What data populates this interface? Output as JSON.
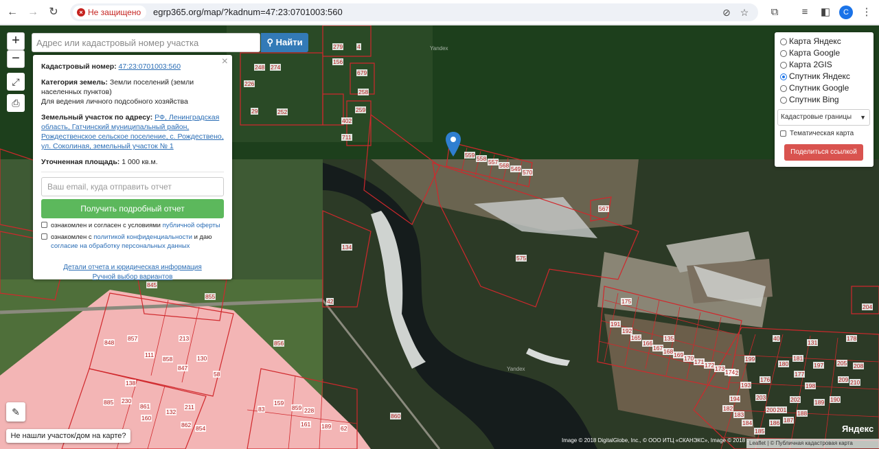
{
  "browser": {
    "security_label": "Не защищено",
    "url": "egrp365.org/map/?kadnum=47:23:0701003:560",
    "profile_initial": "C"
  },
  "search": {
    "placeholder": "Адрес или кадастровый номер участка",
    "button_label": "Найти"
  },
  "zoom": {
    "in_label": "+",
    "out_label": "−"
  },
  "popup": {
    "cadastral_label": "Кадастровый номер:",
    "cadastral_value": "47:23:0701003:560",
    "category_label": "Категория земель:",
    "category_value": "Земли поселений (земли населенных пунктов)",
    "use_value": "Для ведения личного подсобного хозяйства",
    "address_label": "Земельный участок по адресу:",
    "address_value": "РФ, Ленинградская область, Гатчинский муниципальный район, Рождественское сельское поселение, с. Рождествено, ул. Соколиная, земельный участок № 1",
    "area_label": "Уточненная площадь:",
    "area_value": "1 000 кв.м.",
    "email_placeholder": "Ваш email, куда отправить отчет",
    "report_button": "Получить подробный отчет",
    "check1_text": "ознакомлен и согласен с условиями",
    "check1_link": "публичной оферты",
    "check2_text": "ознакомлен с",
    "check2_link": "политикой конфиденциальности",
    "check2_text2": "и даю",
    "check2_link2": "согласие на обработку персональных данных",
    "details_link": "Детали отчета и юридическая информация",
    "manual_link": "Ручной выбор вариантов"
  },
  "layers": {
    "options": [
      {
        "label": "Карта Яндекс",
        "selected": false
      },
      {
        "label": "Карта Google",
        "selected": false
      },
      {
        "label": "Карта 2GIS",
        "selected": false
      },
      {
        "label": "Спутник Яндекс",
        "selected": true
      },
      {
        "label": "Спутник Google",
        "selected": false
      },
      {
        "label": "Спутник Bing",
        "selected": false
      }
    ],
    "overlay_select": "Кадастровые границы",
    "thematic_label": "Тематическая карта",
    "share_button": "Поделиться ссылкой"
  },
  "not_found_label": "Не нашли участок/дом на карте?",
  "attribution": "Image © 2018 DigitalGlobe, Inc., © ООО ИТЦ «СКАНЭКС», Image © 2018 ...",
  "leaflet_attr": "Leaflet | © Публичная кадастровая карта",
  "yandex_logo": "Яндекс",
  "yandex_watermark": "Yandex",
  "parcel_labels": [
    "279",
    "4",
    "156",
    "679",
    "258",
    "259",
    "402",
    "711",
    "274",
    "248",
    "226",
    "252",
    "29",
    "559",
    "558",
    "557",
    "568",
    "549",
    "570",
    "567",
    "575",
    "134",
    "42",
    "845",
    "855",
    "856",
    "848",
    "857",
    "111",
    "213",
    "858",
    "130",
    "847",
    "58",
    "138",
    "885",
    "230",
    "861",
    "160",
    "132",
    "862",
    "211",
    "854",
    "83",
    "159",
    "859",
    "228",
    "189",
    "161",
    "62",
    "860",
    "135",
    "40",
    "131",
    "178",
    "199",
    "212",
    "180",
    "181",
    "197",
    "205",
    "208",
    "209",
    "210",
    "193",
    "194",
    "182",
    "183",
    "184",
    "185",
    "186",
    "187",
    "188",
    "189",
    "190",
    "191",
    "192",
    "165",
    "166",
    "167",
    "168",
    "169",
    "170",
    "171",
    "172",
    "173",
    "174",
    "175",
    "176",
    "177",
    "198",
    "203",
    "200",
    "201",
    "202",
    "204",
    "206",
    "207",
    "125"
  ],
  "colors": {
    "parcel_line": "#d0282c",
    "pink_zone": "#f3b5b5",
    "report_green": "#5cb85c",
    "share_red": "#d9534f",
    "find_blue": "#337ab7"
  }
}
